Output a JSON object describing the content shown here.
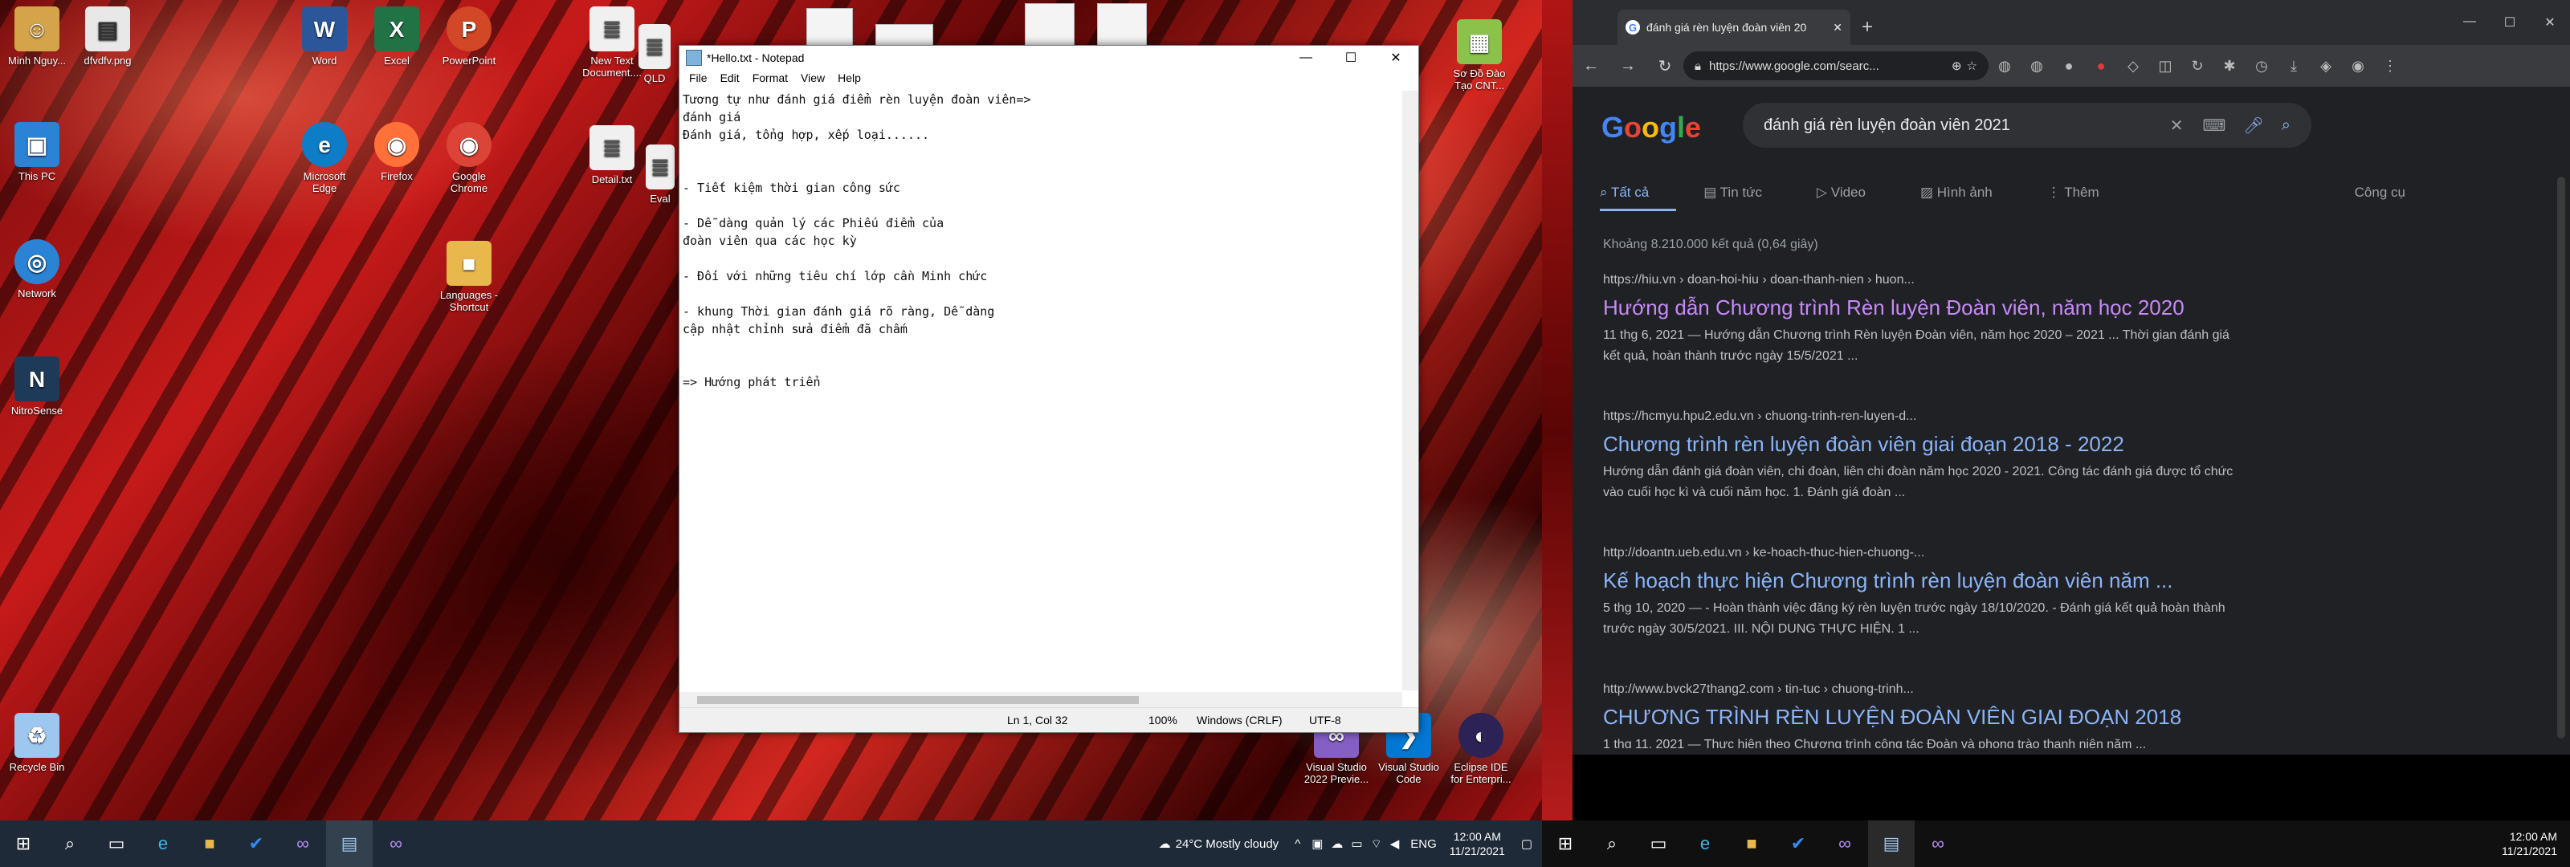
{
  "desktop": {
    "icons": [
      {
        "label": "Minh Nguy...",
        "glyph": "☺",
        "color": "#d4a34a"
      },
      {
        "label": "dfvdfv.png",
        "glyph": "▤",
        "color": "#e8e8e8"
      },
      {
        "label": "This PC",
        "glyph": "▣",
        "color": "#2b83d6"
      },
      {
        "label": "Network",
        "glyph": "◎",
        "color": "#2b83d6"
      },
      {
        "label": "NitroSense",
        "glyph": "N",
        "color": "#1d3a59"
      },
      {
        "label": "Recycle Bin",
        "glyph": "♻",
        "color": "#9ec7ef"
      },
      {
        "label": "Word",
        "glyph": "W",
        "color": "#2b579a"
      },
      {
        "label": "Excel",
        "glyph": "X",
        "color": "#217346"
      },
      {
        "label": "PowerPoint",
        "glyph": "P",
        "color": "#d24726"
      },
      {
        "label": "Microsoft Edge",
        "glyph": "e",
        "color": "#0c7dc6"
      },
      {
        "label": "Firefox",
        "glyph": "◉",
        "color": "#ff7139"
      },
      {
        "label": "Google Chrome",
        "glyph": "◉",
        "color": "#db4437"
      },
      {
        "label": "Languages - Shortcut",
        "glyph": "■",
        "color": "#e8b84d"
      },
      {
        "label": "New Text Document....",
        "glyph": "≣",
        "color": "#f0f0f0"
      },
      {
        "label": "QLD",
        "glyph": "≣",
        "color": "#f0f0f0"
      },
      {
        "label": "Detail.txt",
        "glyph": "≣",
        "color": "#f0f0f0"
      },
      {
        "label": "Eval",
        "glyph": "≣",
        "color": "#f0f0f0"
      },
      {
        "label": "Sơ Đồ Đào Tạo CNT...",
        "glyph": "▦",
        "color": "#8bc34a"
      },
      {
        "label": "Visual Studio 2022 Previe...",
        "glyph": "∞",
        "color": "#865fc5"
      },
      {
        "label": "Visual Studio Code",
        "glyph": "❯",
        "color": "#0078d4"
      },
      {
        "label": "Eclipse IDE for Enterpri...",
        "glyph": "◐",
        "color": "#2c2255"
      }
    ]
  },
  "notepad": {
    "title": "*Hello.txt - Notepad",
    "menu": [
      "File",
      "Edit",
      "Format",
      "View",
      "Help"
    ],
    "lines": [
      "Tương tự như đánh giá điểm rèn luyện đoàn viên=>",
      "đánh giá",
      "Đánh giá, tổng hợp, xếp loại......",
      "",
      "",
      "- Tiết kiệm thời gian công sức",
      "",
      "- Dễ dàng quản lý các Phiếu điểm của",
      "đoàn viên qua các học kỳ",
      "",
      "- Đối với những tiêu chí lớp cần Minh chức",
      "",
      "- khung Thời gian đánh giá rõ ràng, Dễ dàng",
      "cập nhật chỉnh sửa điểm đã chấm",
      "",
      "",
      "=> Hướng phát triển"
    ],
    "status": {
      "position": "Ln 1, Col 32",
      "zoom": "100%",
      "eol": "Windows (CRLF)",
      "encoding": "UTF-8"
    }
  },
  "taskbar1": {
    "weather": "24°C  Mostly cloudy",
    "lang": "ENG",
    "time": "12:00 AM",
    "date": "11/21/2021"
  },
  "browser": {
    "tab_title": "đánh giá rèn luyện đoàn viên 20",
    "url": "https://www.google.com/searc...",
    "query": "đánh giá rèn luyện đoàn viên 2021",
    "nav_tabs": [
      "Tất cả",
      "Tin tức",
      "Video",
      "Hình ảnh",
      "Thêm",
      "Công cụ"
    ],
    "stats": "Khoảng 8.210.000 kết quả (0,64 giây)",
    "results": [
      {
        "url": "https://hiu.vn › doan-hoi-hiu › doan-thanh-nien › huon...",
        "title": "Hướng dẫn Chương trình Rèn luyện Đoàn viên, năm học 2020",
        "snippet": "11 thg 6, 2021 — Hướng dẫn Chương trình Rèn luyện Đoàn viên, năm học 2020 – 2021 ... Thời gian đánh giá kết quả, hoàn thành trước ngày 15/5/2021 ...",
        "color": "#c58af9"
      },
      {
        "url": "https://hcmyu.hpu2.edu.vn › chuong-trinh-ren-luyen-d...",
        "title": "Chương trình rèn luyện đoàn viên giai đoạn 2018 - 2022",
        "snippet": "Hướng dẫn đánh giá đoàn viên, chi đoàn, liên chi đoàn năm học 2020 - 2021. Công tác đánh giá được tổ chức vào cuối học kì và cuối năm học. 1. Đánh giá đoàn ...",
        "color": "#8ab4f8"
      },
      {
        "url": "http://doantn.ueb.edu.vn › ke-hoach-thuc-hien-chuong-...",
        "title": "Kế hoạch thực hiện Chương trình rèn luyện đoàn viên năm ...",
        "snippet": "5 thg 10, 2020 — - Hoàn thành việc đăng ký rèn luyện trước ngày 18/10/2020. - Đánh giá kết quả hoàn thành trước ngày 30/5/2021. III. NỘI DUNG THỰC HIỆN. 1 ...",
        "color": "#8ab4f8"
      },
      {
        "url": "http://www.bvck27thang2.com › tin-tuc › chuong-trinh...",
        "title": "CHƯƠNG TRÌNH RÈN LUYỆN ĐOÀN VIÊN GIAI ĐOẠN 2018",
        "snippet": "1 thg 11, 2021 — Thực hiện theo Chương trình công tác Đoàn và phong trào thanh niên năm ...",
        "color": "#8ab4f8"
      }
    ]
  },
  "taskbar2": {
    "time": "12:00 AM",
    "date": "11/21/2021"
  }
}
